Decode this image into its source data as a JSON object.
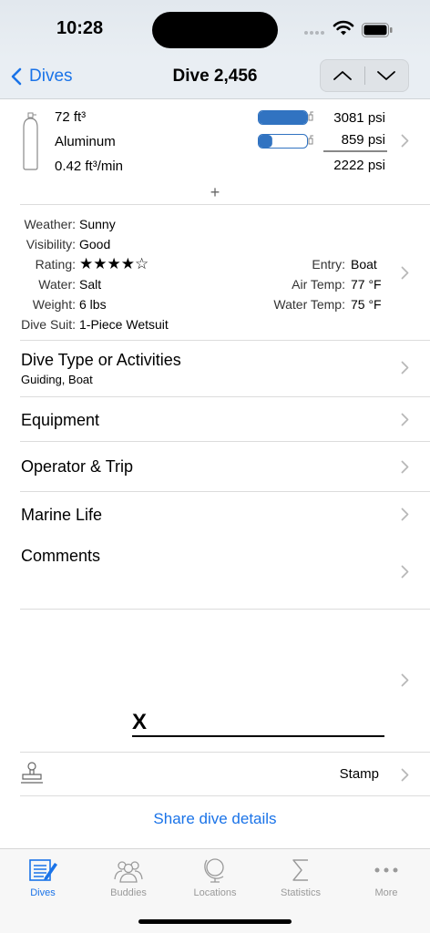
{
  "status": {
    "time": "10:28"
  },
  "nav": {
    "back_label": "Dives",
    "title": "Dive 2,456"
  },
  "tank": {
    "volume": "72 ft³",
    "material": "Aluminum",
    "sac_rate": "0.42 ft³/min",
    "start_pressure": "3081 psi",
    "end_pressure": "859 psi",
    "used_pressure": "2222 psi",
    "start_fill": 1.0,
    "end_fill": 0.28,
    "add_label": "+"
  },
  "conditions": {
    "weather": {
      "label": "Weather:",
      "value": "Sunny"
    },
    "visibility": {
      "label": "Visibility:",
      "value": "Good"
    },
    "rating": {
      "label": "Rating:",
      "value": "★★★★☆",
      "stars": 4,
      "max": 5
    },
    "water": {
      "label": "Water:",
      "value": "Salt"
    },
    "weight": {
      "label": "Weight:",
      "value": "6 lbs"
    },
    "suit": {
      "label": "Dive Suit:",
      "value": "1-Piece Wetsuit"
    },
    "entry": {
      "label": "Entry:",
      "value": "Boat"
    },
    "air_temp": {
      "label": "Air Temp:",
      "value": "77 °F"
    },
    "water_temp": {
      "label": "Water Temp:",
      "value": "75 °F"
    }
  },
  "rows": {
    "dive_type": {
      "title": "Dive Type or Activities",
      "subtitle": "Guiding, Boat"
    },
    "equipment": {
      "title": "Equipment"
    },
    "operator": {
      "title": "Operator & Trip"
    },
    "marine_life": {
      "title": "Marine Life"
    },
    "comments": {
      "title": "Comments"
    }
  },
  "signature": {
    "mark": "X"
  },
  "stamp": {
    "label": "Stamp"
  },
  "share": {
    "label": "Share dive details"
  },
  "tabs": [
    {
      "label": "Dives",
      "icon": "dive-log-icon",
      "active": true
    },
    {
      "label": "Buddies",
      "icon": "buddies-icon",
      "active": false
    },
    {
      "label": "Locations",
      "icon": "globe-icon",
      "active": false
    },
    {
      "label": "Statistics",
      "icon": "sigma-icon",
      "active": false
    },
    {
      "label": "More",
      "icon": "more-icon",
      "active": false
    }
  ],
  "colors": {
    "accent": "#1a73e8",
    "tank_fill": "#3173c1",
    "inactive_tab": "#9a9a9a"
  }
}
